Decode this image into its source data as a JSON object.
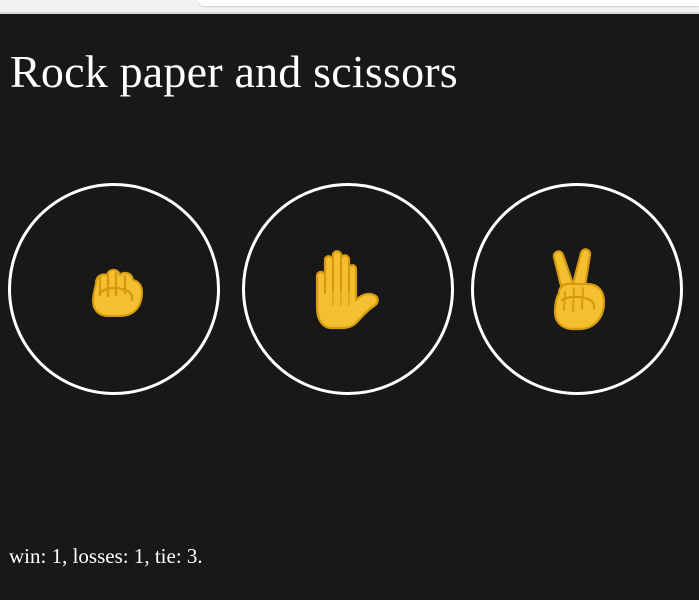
{
  "window": {
    "title": "Rock paper and scissors"
  },
  "choices": [
    {
      "name": "Rock",
      "icon": "rock-hand-icon",
      "glyph_color": "#f4c02f"
    },
    {
      "name": "Paper",
      "icon": "paper-hand-icon",
      "glyph_color": "#f4c02f"
    },
    {
      "name": "Scissors",
      "icon": "scissors-hand-icon",
      "glyph_color": "#f4c02f"
    }
  ],
  "score": {
    "text": "win: 1, losses: 1, tie: 3."
  },
  "colors": {
    "background": "#181818",
    "foreground": "#ffffff",
    "accent": "#f4c02f",
    "outline": "#d59a10"
  }
}
